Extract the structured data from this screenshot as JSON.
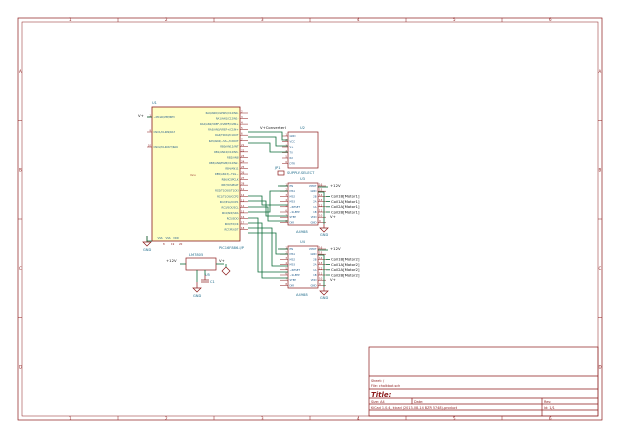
{
  "frame": {
    "columns": [
      "1",
      "2",
      "3",
      "4",
      "5",
      "6"
    ],
    "rows": [
      "A",
      "B",
      "C",
      "D"
    ]
  },
  "u1": {
    "ref": "U1",
    "value": "PIC16F886-I/P",
    "label": "mcu",
    "left_pins": [
      {
        "num": "1",
        "name": "~MCLR/VPP/RE3"
      },
      {
        "num": "9",
        "name": "OSC1/CLKIN/RA7"
      },
      {
        "num": "10",
        "name": "OSC2/CLKOUT/RA6"
      }
    ],
    "right_pins": [
      {
        "num": "2",
        "name": "RA0/AN0/ULPWU/C12IN0-"
      },
      {
        "num": "3",
        "name": "RA1/AN1/C12IN1-"
      },
      {
        "num": "4",
        "name": "RA2/AN2/VREF-/CVREF/C2IN+"
      },
      {
        "num": "5",
        "name": "RA3/AN3/VREF+/C1IN+"
      },
      {
        "num": "6",
        "name": "RA4/T0CKI/C1OUT"
      },
      {
        "num": "7",
        "name": "RA5/AN4/~SS~/C2OUT"
      },
      {
        "num": "21",
        "name": "RB0/AN12/INT"
      },
      {
        "num": "22",
        "name": "RB1/AN10/C12IN3-"
      },
      {
        "num": "23",
        "name": "RB2/AN8"
      },
      {
        "num": "24",
        "name": "RB3/AN9/PGM/C12IN2-"
      },
      {
        "num": "25",
        "name": "RB4/AN11"
      },
      {
        "num": "26",
        "name": "RB5/AN13/~T1G~"
      },
      {
        "num": "27",
        "name": "RB6/ICSPCLK"
      },
      {
        "num": "28",
        "name": "RB7/ICSPDAT"
      },
      {
        "num": "11",
        "name": "RC0/T1OSO/T1CKI"
      },
      {
        "num": "12",
        "name": "RC1/T1OSI/CCP2"
      },
      {
        "num": "13",
        "name": "RC2/P1A/CCP1"
      },
      {
        "num": "14",
        "name": "RC3/SCK/SCL"
      },
      {
        "num": "15",
        "name": "RC4/SDI/SDA"
      },
      {
        "num": "16",
        "name": "RC5/SDO"
      },
      {
        "num": "17",
        "name": "RC6/TX/CK"
      },
      {
        "num": "18",
        "name": "RC7/RX/DT"
      }
    ],
    "bottom_pins": [
      {
        "num": "8",
        "name": "VSS"
      },
      {
        "num": "19",
        "name": "VSS"
      },
      {
        "num": "20",
        "name": "VDD"
      }
    ]
  },
  "u2": {
    "ref": "U2",
    "pins": [
      {
        "num": "1",
        "name": "GND"
      },
      {
        "num": "2",
        "name": "VCC"
      },
      {
        "num": "3",
        "name": "V+"
      },
      {
        "num": "4",
        "name": "TX"
      },
      {
        "num": "5",
        "name": "RX"
      },
      {
        "num": "6",
        "name": "DTR"
      }
    ]
  },
  "u3": {
    "ref": "U3",
    "value": "A4988",
    "left_pins": [
      {
        "num": "1",
        "name": "EN"
      },
      {
        "num": "2",
        "name": "MS1"
      },
      {
        "num": "3",
        "name": "MS2"
      },
      {
        "num": "4",
        "name": "MS3"
      },
      {
        "num": "5",
        "name": "~RESET"
      },
      {
        "num": "6",
        "name": "~SLEEP"
      },
      {
        "num": "7",
        "name": "STEP"
      },
      {
        "num": "8",
        "name": "DIR"
      }
    ],
    "right_pins": [
      {
        "num": "16",
        "name": "VMOT"
      },
      {
        "num": "15",
        "name": "GND"
      },
      {
        "num": "14",
        "name": "2B"
      },
      {
        "num": "13",
        "name": "2A"
      },
      {
        "num": "12",
        "name": "1A"
      },
      {
        "num": "11",
        "name": "1B"
      },
      {
        "num": "10",
        "name": "VDD"
      },
      {
        "num": "9",
        "name": "GND"
      }
    ],
    "nets": [
      "Coil1B[Motor1]",
      "Coil1A[Motor1]",
      "Coil2A[Motor1]",
      "Coil2B[Motor1]"
    ]
  },
  "u4": {
    "ref": "U4",
    "value": "A4988",
    "left_pins": [
      {
        "num": "1",
        "name": "EN"
      },
      {
        "num": "2",
        "name": "MS1"
      },
      {
        "num": "3",
        "name": "MS2"
      },
      {
        "num": "4",
        "name": "MS3"
      },
      {
        "num": "5",
        "name": "~RESET"
      },
      {
        "num": "6",
        "name": "~SLEEP"
      },
      {
        "num": "7",
        "name": "STEP"
      },
      {
        "num": "8",
        "name": "DIR"
      }
    ],
    "right_pins": [
      {
        "num": "16",
        "name": "VMOT"
      },
      {
        "num": "15",
        "name": "GND"
      },
      {
        "num": "14",
        "name": "2B"
      },
      {
        "num": "13",
        "name": "2A"
      },
      {
        "num": "12",
        "name": "1A"
      },
      {
        "num": "11",
        "name": "1B"
      },
      {
        "num": "10",
        "name": "VDD"
      },
      {
        "num": "9",
        "name": "GND"
      }
    ],
    "nets": [
      "Coil1B[Motor2]",
      "Coil1A[Motor2]",
      "Coil2A[Motor2]",
      "Coil2B[Motor2]"
    ]
  },
  "u5": {
    "ref": "U5",
    "value": "LM7805"
  },
  "jumper": {
    "ref": "JP1",
    "value": "SUPPLY-SELECT"
  },
  "c1": {
    "ref": "C1"
  },
  "labels": {
    "v_plus": "V+",
    "plus12v": "+12V",
    "gnd": "GND",
    "vcc_ext": "V+ConverterI"
  },
  "title_block": {
    "sheet": "Sheet: /",
    "file": "File: chalkbot.sch",
    "title_label": "Title:",
    "size_label": "Size: A4",
    "date_label": "Date:",
    "rev_label": "Rev:",
    "kicad": "KiCad 1.0.4, kicad (2013-08-14 BZR 5748)-product",
    "id": "Id: 1/1"
  }
}
